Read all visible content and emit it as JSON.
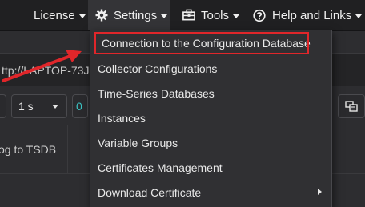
{
  "navbar": {
    "license": "License",
    "settings": "Settings",
    "tools": "Tools",
    "help": "Help and Links"
  },
  "background": {
    "url_text": "ttp://LAPTOP-73J",
    "interval_value": "1 s",
    "teal_value": "0",
    "panel_text": "og to TSDB"
  },
  "settings_menu": {
    "items": [
      {
        "label": "Connection to the Configuration Database"
      },
      {
        "label": "Collector Configurations"
      },
      {
        "label": "Time-Series Databases"
      },
      {
        "label": "Instances"
      },
      {
        "label": "Variable Groups"
      },
      {
        "label": "Certificates Management"
      },
      {
        "label": "Download Certificate"
      }
    ]
  },
  "colors": {
    "highlight_outline": "#e0262a",
    "annotation_arrow": "#e0262a",
    "teal_accent": "#3cc4c4"
  },
  "icons": {
    "settings": "gear-icon",
    "tools": "toolbox-icon",
    "help": "help-circle-icon",
    "download_submenu": "chevron-right-icon",
    "panel_control": "layout-icon"
  }
}
